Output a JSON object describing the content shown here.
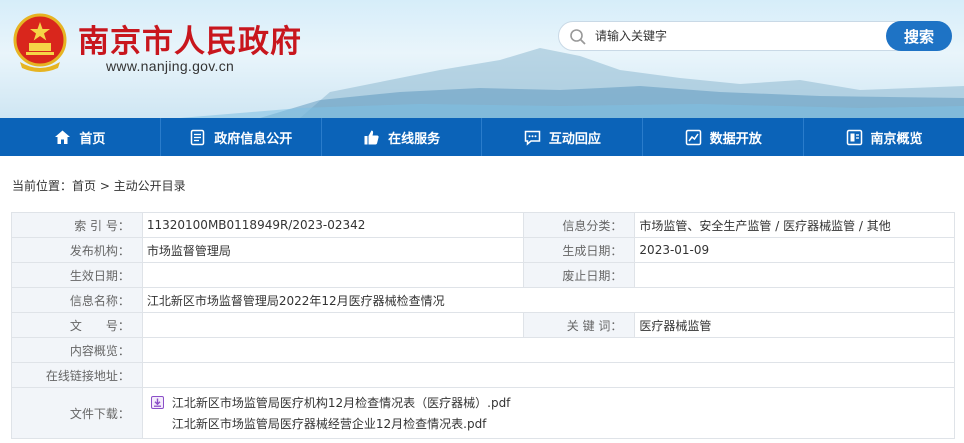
{
  "header": {
    "title": "南京市人民政府",
    "url": "www.nanjing.gov.cn",
    "search_placeholder": "请输入关键字",
    "search_button": "搜索"
  },
  "nav": [
    {
      "label": "首页",
      "icon": "home-icon"
    },
    {
      "label": "政府信息公开",
      "icon": "document-icon"
    },
    {
      "label": "在线服务",
      "icon": "thumbs-up-icon"
    },
    {
      "label": "互动回应",
      "icon": "chat-icon"
    },
    {
      "label": "数据开放",
      "icon": "chart-icon"
    },
    {
      "label": "南京概览",
      "icon": "info-icon"
    }
  ],
  "breadcrumb": "当前位置：首页 > 主动公开目录",
  "info": {
    "index_label": "索 引 号：",
    "index_value": "11320100MB0118949R/2023-02342",
    "category_label": "信息分类：",
    "category_value": "市场监管、安全生产监管 / 医疗器械监管 / 其他",
    "publisher_label": "发布机构：",
    "publisher_value": "市场监督管理局",
    "created_label": "生成日期：",
    "created_value": "2023-01-09",
    "effective_label": "生效日期：",
    "effective_value": "",
    "expiry_label": "废止日期：",
    "expiry_value": "",
    "name_label": "信息名称：",
    "name_value": "江北新区市场监督管理局2022年12月医疗器械检查情况",
    "docno_label": "文　　号：",
    "docno_value": "",
    "keywords_label": "关 键 词：",
    "keywords_value": "医疗器械监管",
    "summary_label": "内容概览：",
    "summary_value": "",
    "link_label": "在线链接地址：",
    "link_value": "",
    "files_label": "文件下载：",
    "files": [
      "江北新区市场监管局医疗机构12月检查情况表（医疗器械）.pdf",
      "江北新区市场监管局医疗器械经营企业12月检查情况表.pdf"
    ]
  },
  "colors": {
    "brand_red": "#c8161d",
    "nav_blue": "#0b63b8",
    "search_blue": "#1e73c5"
  }
}
